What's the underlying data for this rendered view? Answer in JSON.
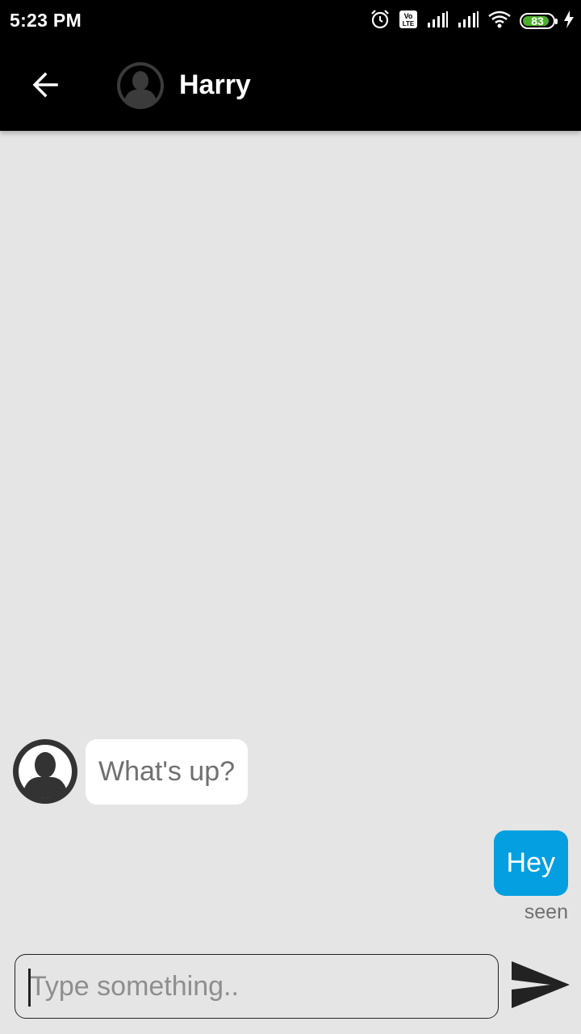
{
  "status_bar": {
    "time": "5:23 PM",
    "battery": "83",
    "icons": [
      "alarm-icon",
      "volte-icon",
      "signal-icon",
      "signal-icon",
      "wifi-icon",
      "battery-icon",
      "charging-icon"
    ]
  },
  "header": {
    "contact_name": "Harry",
    "back_icon": "arrow-back-icon",
    "avatar_icon": "person-avatar-icon"
  },
  "messages": [
    {
      "direction": "incoming",
      "text": "What's up?"
    },
    {
      "direction": "outgoing",
      "text": "Hey",
      "status": "seen"
    }
  ],
  "composer": {
    "placeholder": "Type something..",
    "value": "",
    "send_icon": "send-icon"
  },
  "colors": {
    "app_bar": "#000000",
    "background": "#e5e5e5",
    "outgoing_bubble": "#049fe0",
    "incoming_bubble": "#ffffff",
    "battery_fill": "#4caf2a"
  }
}
